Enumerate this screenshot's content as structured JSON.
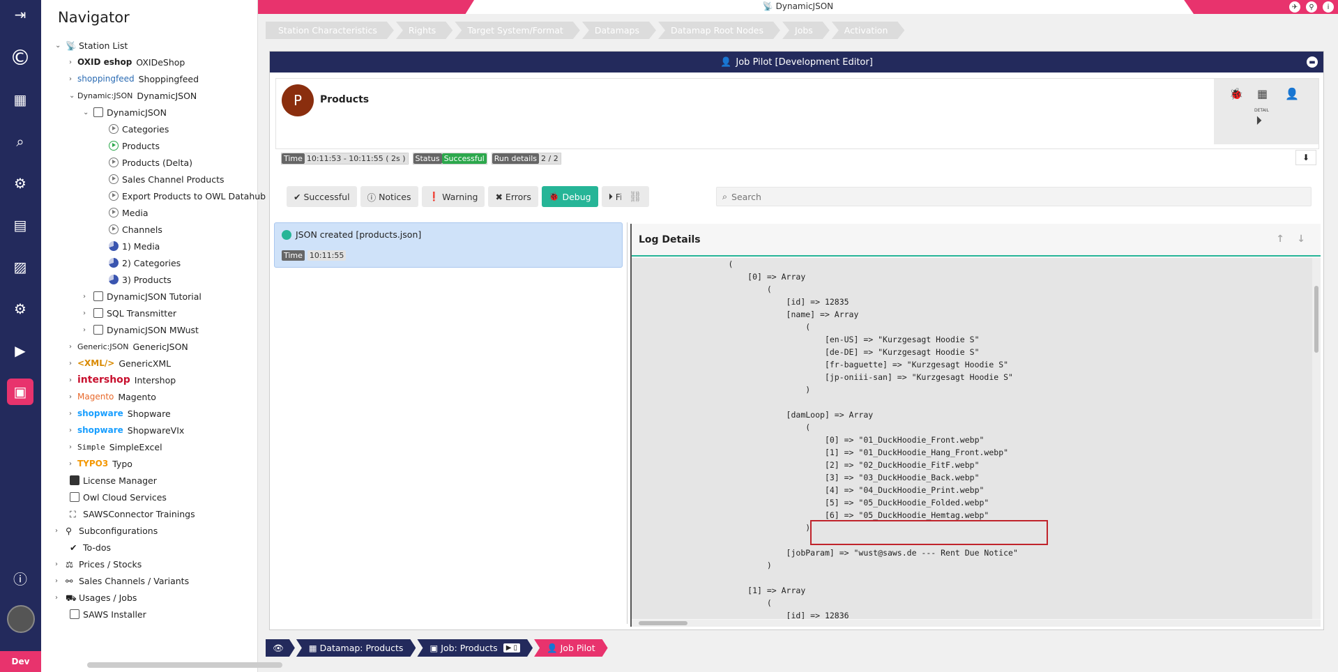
{
  "window": {
    "title": "DynamicJSON"
  },
  "rail": {
    "env": "Dev"
  },
  "navigator": {
    "title": "Navigator",
    "items": [
      {
        "label": "Station List",
        "logo": ""
      },
      {
        "label": "OXIDeShop",
        "logo": "OXID eshop"
      },
      {
        "label": "Shoppingfeed",
        "logo": "shoppingfeed"
      },
      {
        "label": "DynamicJSON",
        "logo": "Dynamic:JSON"
      },
      {
        "label": "DynamicJSON",
        "logo": ""
      },
      {
        "label": "Categories",
        "logo": ""
      },
      {
        "label": "Products",
        "logo": ""
      },
      {
        "label": "Products (Delta)",
        "logo": ""
      },
      {
        "label": "Sales Channel Products",
        "logo": ""
      },
      {
        "label": "Export Products to OWL Datahub",
        "logo": ""
      },
      {
        "label": "Media",
        "logo": ""
      },
      {
        "label": "Channels",
        "logo": ""
      },
      {
        "label": "1) Media",
        "logo": ""
      },
      {
        "label": "2) Categories",
        "logo": ""
      },
      {
        "label": "3) Products",
        "logo": ""
      },
      {
        "label": "DynamicJSON Tutorial",
        "logo": ""
      },
      {
        "label": "SQL Transmitter",
        "logo": ""
      },
      {
        "label": "DynamicJSON MWust",
        "logo": ""
      },
      {
        "label": "GenericJSON",
        "logo": "Generic:JSON"
      },
      {
        "label": "GenericXML",
        "logo": "<XML/>"
      },
      {
        "label": "Intershop",
        "logo": "intershop"
      },
      {
        "label": "Magento",
        "logo": "Magento"
      },
      {
        "label": "Shopware",
        "logo": "shopware"
      },
      {
        "label": "ShopwareVIx",
        "logo": "shopware"
      },
      {
        "label": "SimpleExcel",
        "logo": "Simple"
      },
      {
        "label": "Typo",
        "logo": "TYPO3"
      },
      {
        "label": "License Manager",
        "logo": ""
      },
      {
        "label": "Owl Cloud Services",
        "logo": ""
      },
      {
        "label": "SAWSConnector Trainings",
        "logo": ""
      },
      {
        "label": "Subconfigurations",
        "logo": ""
      },
      {
        "label": "To-dos",
        "logo": ""
      },
      {
        "label": "Prices / Stocks",
        "logo": ""
      },
      {
        "label": "Sales Channels / Variants",
        "logo": ""
      },
      {
        "label": "Usages / Jobs",
        "logo": ""
      },
      {
        "label": "SAWS Installer",
        "logo": ""
      }
    ]
  },
  "steps": [
    "Station Characteristics",
    "Rights",
    "Target System/Format",
    "Datamaps",
    "Datamap Root Nodes",
    "Jobs",
    "Activation"
  ],
  "panel": {
    "title": "Job Pilot [Development Editor]",
    "job_initial": "P",
    "job_name": "Products",
    "detail_label": "DETAIL",
    "time_label": "Time",
    "time_value": "10:11:53 - 10:11:55 ( 2s )",
    "status_label": "Status",
    "status_value": "Successful",
    "run_label": "Run details",
    "run_value": "2 / 2"
  },
  "filters": [
    "Successful",
    "Notices",
    "Warning",
    "Errors",
    "Debug",
    "File"
  ],
  "active_filter": "Debug",
  "search": {
    "placeholder": "Search"
  },
  "log_entry": {
    "title": "JSON created [products.json]",
    "time_label": "Time",
    "time_value": "10:11:55"
  },
  "log_details": {
    "title": "Log Details",
    "lines": [
      "                    (",
      "                        [0] => Array",
      "                            (",
      "                                [id] => 12835",
      "                                [name] => Array",
      "                                    (",
      "                                        [en-US] => \"Kurzgesagt Hoodie S\"",
      "                                        [de-DE] => \"Kurzgesagt Hoodie S\"",
      "                                        [fr-baguette] => \"Kurzgesagt Hoodie S\"",
      "                                        [jp-oniii-san] => \"Kurzgesagt Hoodie S\"",
      "                                    )",
      "",
      "                                [damLoop] => Array",
      "                                    (",
      "                                        [0] => \"01_DuckHoodie_Front.webp\"",
      "                                        [1] => \"01_DuckHoodie_Hang_Front.webp\"",
      "                                        [2] => \"02_DuckHoodie_FitF.webp\"",
      "                                        [3] => \"03_DuckHoodie_Back.webp\"",
      "                                        [4] => \"04_DuckHoodie_Print.webp\"",
      "                                        [5] => \"05_DuckHoodie_Folded.webp\"",
      "                                        [6] => \"05_DuckHoodie_Hemtag.webp\"",
      "                                    )",
      "",
      "                                [jobParam] => \"wust@saws.de --- Rent Due Notice\"",
      "                            )",
      "",
      "                        [1] => Array",
      "                            (",
      "                                [id] => 12836"
    ]
  },
  "crumbs": [
    "Datamap: Products",
    "Job: Products",
    "Job Pilot"
  ],
  "colors": {
    "navy": "#232a5c",
    "pink": "#e8336d",
    "teal": "#26b597",
    "green": "#2ca84c",
    "highlight": "#c0232b"
  }
}
